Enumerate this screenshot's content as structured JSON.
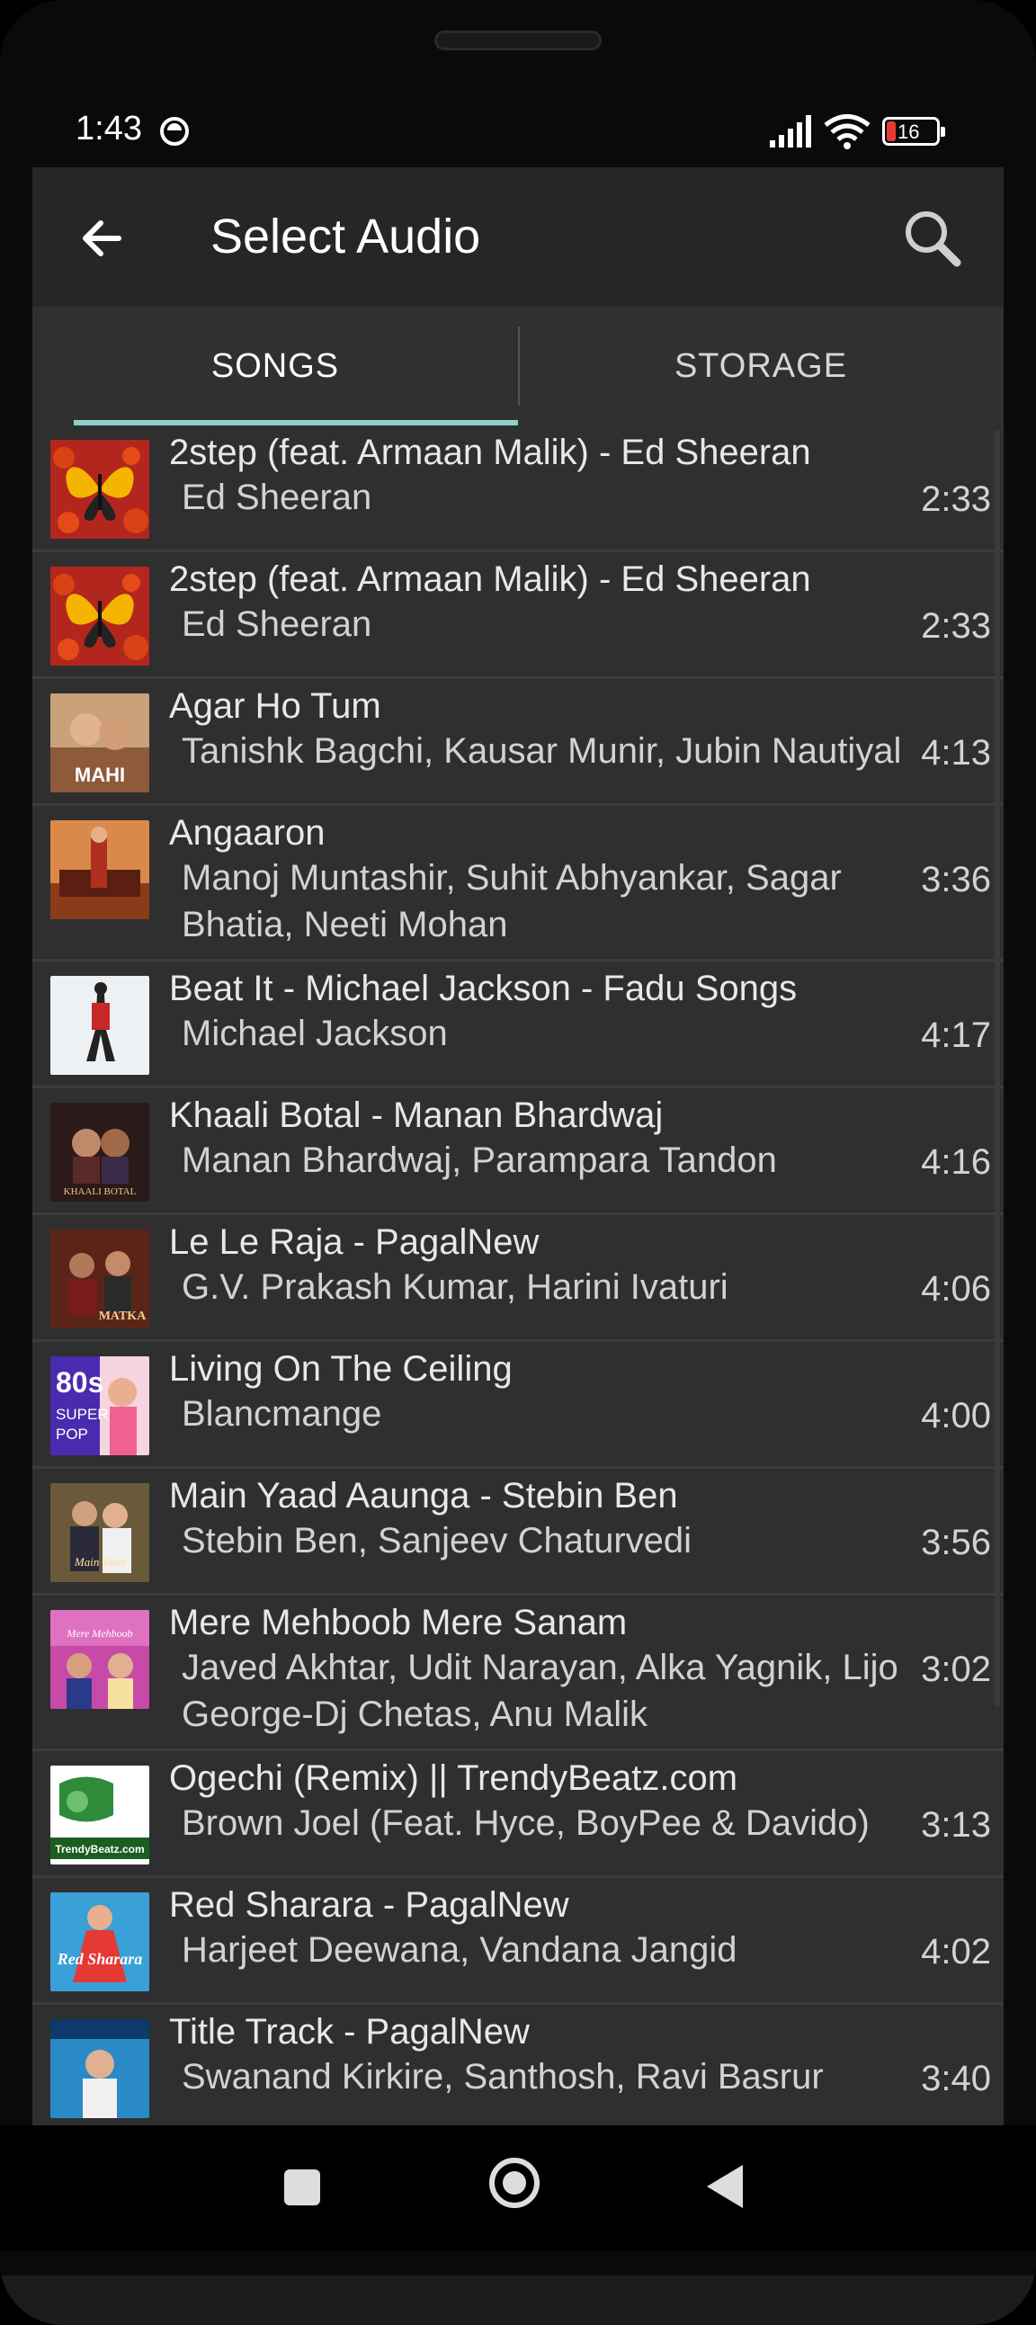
{
  "status_bar": {
    "time": "1:43",
    "battery": "16",
    "battery_color": "#e53935"
  },
  "app_bar": {
    "title": "Select Audio",
    "back_icon": "arrow-left-icon",
    "search_icon": "search-icon"
  },
  "tabs": [
    {
      "label": "SONGS",
      "selected": true
    },
    {
      "label": "STORAGE",
      "selected": false
    }
  ],
  "accent_color": "#8fcfc8",
  "songs": [
    {
      "title": "2step (feat. Armaan Malik) - Ed Sheeran",
      "artist": "Ed Sheeran",
      "duration": "2:33",
      "art": "butterfly"
    },
    {
      "title": "2step (feat. Armaan Malik) - Ed Sheeran",
      "artist": "Ed Sheeran",
      "duration": "2:33",
      "art": "butterfly"
    },
    {
      "title": "Agar Ho Tum",
      "artist": "Tanishk Bagchi, Kausar Munir, Jubin Nautiyal",
      "duration": "4:13",
      "art": "mahi",
      "art_text": "MAHI"
    },
    {
      "title": "Angaaron",
      "artist": "Manoj Muntashir, Suhit Abhyankar, Sagar Bhatia, Neeti Mohan",
      "duration": "3:36",
      "art": "angaaron"
    },
    {
      "title": "Beat It - Michael Jackson - Fadu Songs",
      "artist": "Michael Jackson",
      "duration": "4:17",
      "art": "beatit"
    },
    {
      "title": "Khaali Botal - Manan Bhardwaj",
      "artist": "Manan Bhardwaj, Parampara Tandon",
      "duration": "4:16",
      "art": "khaali",
      "art_text": "KHAALI BOTAL"
    },
    {
      "title": "Le Le Raja - PagalNew",
      "artist": "G.V. Prakash Kumar, Harini Ivaturi",
      "duration": "4:06",
      "art": "matka",
      "art_text": "MATKA"
    },
    {
      "title": "Living On The Ceiling",
      "artist": "Blancmange",
      "duration": "4:00",
      "art": "80s",
      "art_text": "80s SUPER POP"
    },
    {
      "title": "Main Yaad Aaunga - Stebin Ben",
      "artist": "Stebin Ben, Sanjeev Chaturvedi",
      "duration": "3:56",
      "art": "yaad"
    },
    {
      "title": "Mere Mehboob Mere Sanam",
      "artist": "Javed Akhtar, Udit Narayan, Alka Yagnik, Lijo George-Dj Chetas, Anu Malik",
      "duration": "3:02",
      "art": "mere"
    },
    {
      "title": "Ogechi (Remix) || TrendyBeatz.com",
      "artist": "Brown Joel (Feat. Hyce, BoyPee & Davido)",
      "duration": "3:13",
      "art": "trendy",
      "art_text": "TrendyBeatz.com"
    },
    {
      "title": "Red Sharara - PagalNew",
      "artist": "Harjeet Deewana, Vandana Jangid",
      "duration": "4:02",
      "art": "sharara",
      "art_text": "Red Sharara"
    },
    {
      "title": "Title Track - PagalNew",
      "artist": "Swanand Kirkire, Santhosh, Ravi Basrur",
      "duration": "3:40",
      "art": "title"
    }
  ],
  "nav_bar": {
    "recent_icon": "square-recents-icon",
    "home_icon": "circle-home-icon",
    "back_icon": "triangle-back-icon"
  }
}
